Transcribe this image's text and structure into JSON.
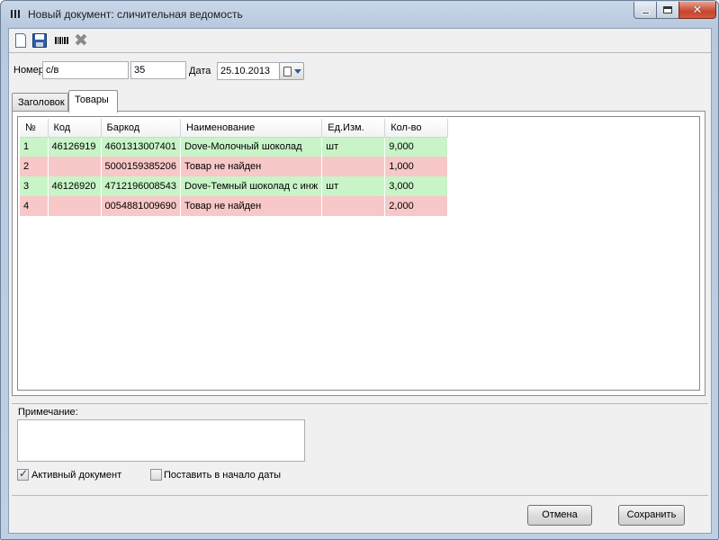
{
  "window": {
    "title": "Новый документ: сличительная ведомость"
  },
  "toolbar": {
    "icons": [
      "new-document-icon",
      "save-icon",
      "barcode-icon",
      "delete-icon"
    ]
  },
  "header": {
    "number_label": "Номер",
    "number_prefix": "с/в",
    "number_value": "35",
    "date_label": "Дата",
    "date_value": "25.10.2013"
  },
  "tabs": [
    {
      "label": "Заголовок",
      "active": false
    },
    {
      "label": "Товары",
      "active": true
    }
  ],
  "grid": {
    "columns": [
      "№",
      "Код",
      "Баркод",
      "Наименование",
      "Ед.Изм.",
      "Кол-во"
    ],
    "rows": [
      {
        "cells": [
          "1",
          "46126919",
          "4601313007401",
          "Dove-Молочный шоколад",
          "шт",
          "9,000"
        ],
        "status": "found"
      },
      {
        "cells": [
          "2",
          "",
          "5000159385206",
          "Товар не найден",
          "",
          "1,000"
        ],
        "status": "not-found"
      },
      {
        "cells": [
          "3",
          "46126920",
          "4712196008543",
          "Dove-Темный шоколад с инж",
          "шт",
          "3,000"
        ],
        "status": "found"
      },
      {
        "cells": [
          "4",
          "",
          "0054881009690",
          "Товар не найден",
          "",
          "2,000"
        ],
        "status": "not-found"
      }
    ],
    "colors": {
      "found": "#c8f4c8",
      "not_found": "#f8c8c8"
    }
  },
  "footer": {
    "note_label": "Примечание:",
    "note_value": "",
    "active_doc_label": "Активный документ",
    "active_doc_checked": true,
    "put_first_label": "Поставить в начало даты",
    "put_first_checked": false
  },
  "buttons": {
    "cancel": "Отмена",
    "save": "Сохранить"
  }
}
